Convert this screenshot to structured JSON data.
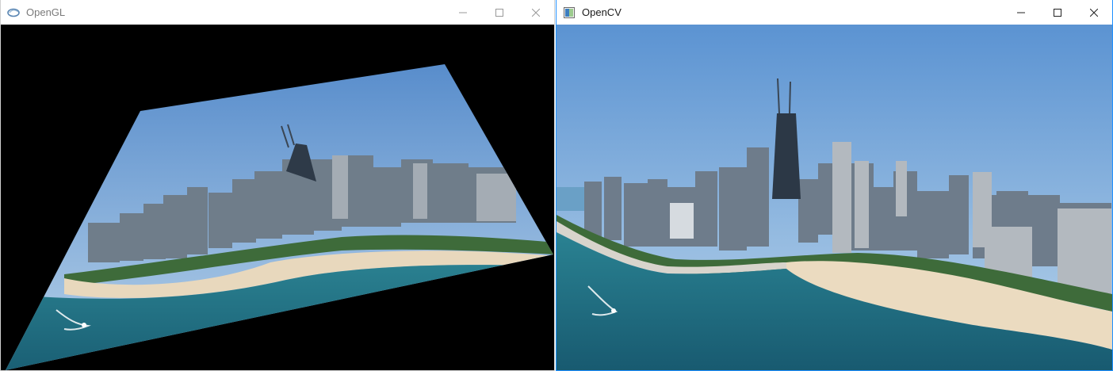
{
  "windows": {
    "opengl": {
      "title": "OpenGL",
      "icon": "opengl-app-icon",
      "active": false
    },
    "opencv": {
      "title": "OpenCV",
      "icon": "opencv-app-icon",
      "active": true
    }
  },
  "controls": {
    "minimize_icon": "minimize-icon",
    "maximize_icon": "maximize-icon",
    "close_icon": "close-icon"
  },
  "colors": {
    "sky_top": "#4d86c9",
    "sky_bottom": "#b9d4ea",
    "water": "#1f6f7c",
    "beach": "#e8d8bd",
    "active_border": "#1e90ff"
  }
}
